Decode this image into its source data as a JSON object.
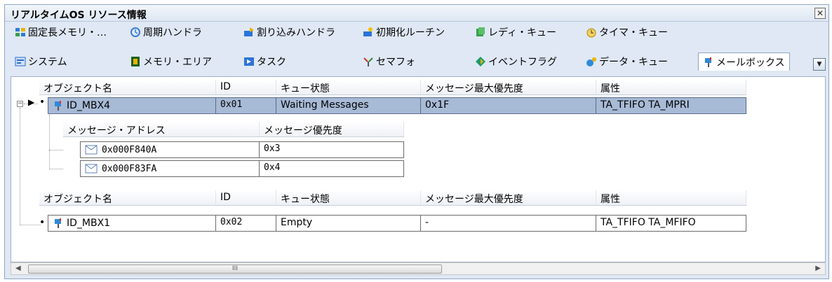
{
  "window": {
    "title": "リアルタイムOS リソース情報",
    "close": "✕"
  },
  "tabs_row1": [
    {
      "label": "固定長メモリ・…",
      "icon": "fixed-memory-icon",
      "color": "#2e7bd6"
    },
    {
      "label": "周期ハンドラ",
      "icon": "cyclic-handler-icon",
      "color": "#3a7ed6"
    },
    {
      "label": "割り込みハンドラ",
      "icon": "interrupt-handler-icon",
      "color": "#2b74d8"
    },
    {
      "label": "初期化ルーチン",
      "icon": "init-routine-icon",
      "color": "#e8b400"
    },
    {
      "label": "レディ・キュー",
      "icon": "ready-queue-icon",
      "color": "#37a04a"
    },
    {
      "label": "タイマ・キュー",
      "icon": "timer-queue-icon",
      "color": "#d4a000"
    }
  ],
  "tabs_row2": [
    {
      "label": "システム",
      "icon": "system-icon",
      "color": "#2e6bd0"
    },
    {
      "label": "メモリ・エリア",
      "icon": "memory-area-icon",
      "color": "#2a8a2a"
    },
    {
      "label": "タスク",
      "icon": "task-icon",
      "color": "#2f74d6"
    },
    {
      "label": "セマフォ",
      "icon": "semaphore-icon",
      "color": "#c83030"
    },
    {
      "label": "イベントフラグ",
      "icon": "eventflag-icon",
      "color": "#1e9a6b"
    },
    {
      "label": "データ・キュー",
      "icon": "data-queue-icon",
      "color": "#2f8ad8"
    },
    {
      "label": "メールボックス",
      "icon": "mailbox-icon",
      "color": "#2f8ad8",
      "active": true
    }
  ],
  "columns": [
    "オブジェクト名",
    "ID",
    "キュー状態",
    "メッセージ最大優先度",
    "属性"
  ],
  "sub_columns": [
    "メッセージ・アドレス",
    "メッセージ優先度"
  ],
  "rows": [
    {
      "name": "ID_MBX4",
      "id": "0x01",
      "queue": "Waiting Messages",
      "maxpri": "0x1F",
      "attr": "TA_TFIFO TA_MPRI",
      "selected": true,
      "messages": [
        {
          "address": "0x000F840A",
          "priority": "0x3"
        },
        {
          "address": "0x000F83FA",
          "priority": "0x4"
        }
      ]
    },
    {
      "name": "ID_MBX1",
      "id": "0x02",
      "queue": "Empty",
      "maxpri": "-",
      "attr": "TA_TFIFO TA_MFIFO",
      "selected": false
    }
  ],
  "scrollbar": {
    "thumb_grip": "III",
    "left_arrow": "◀",
    "right_arrow": "▶"
  }
}
